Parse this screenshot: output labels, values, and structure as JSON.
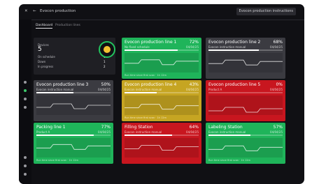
{
  "header": {
    "title": "Evocon production",
    "action_label": "Evocon production instructions"
  },
  "tabs": [
    "Dashboard",
    "Production lines"
  ],
  "summary": {
    "label": "Devices",
    "total": "5",
    "rows": [
      {
        "label": "On schedule",
        "value": "1"
      },
      {
        "label": "Down",
        "value": "1"
      },
      {
        "label": "In progress",
        "value": "2"
      }
    ]
  },
  "cards": [
    {
      "title": "Evocon production line 1",
      "subtitle": "No fixed schedule",
      "percent": "72%",
      "progress": 0.72,
      "meta": "04/04/25",
      "status": "green",
      "foot": "Run time since first scan · 1h 12m"
    },
    {
      "title": "Evocon production line 2",
      "subtitle": "Evocon instruction manual",
      "percent": "68%",
      "progress": 0.68,
      "meta": "04/04/25",
      "status": "gray",
      "foot": ""
    },
    {
      "title": "Evocon production line 3",
      "subtitle": "Evocon instruction manual",
      "percent": "50%",
      "progress": 0.5,
      "meta": "04/04/25",
      "status": "gray",
      "foot": ""
    },
    {
      "title": "Evocon production line 4",
      "subtitle": "Evocon instruction manual",
      "percent": "43%",
      "progress": 0.43,
      "meta": "04/04/25",
      "status": "yellow",
      "foot": "Run time since first scan · 1h 12m"
    },
    {
      "title": "Evocon production line 5",
      "subtitle": "Product A",
      "percent": "0%",
      "progress": 0.0,
      "meta": "04/04/25",
      "status": "red",
      "foot": ""
    },
    {
      "title": "Packing line 1",
      "subtitle": "Product A",
      "percent": "77%",
      "progress": 0.77,
      "meta": "04/04/25",
      "status": "green",
      "foot": "Run time since first scan · 1h 12m"
    },
    {
      "title": "Filling Station",
      "subtitle": "Evocon instruction manual",
      "percent": "64%",
      "progress": 0.64,
      "meta": "04/04/25",
      "status": "red",
      "foot": ""
    },
    {
      "title": "Labeling Station",
      "subtitle": "Evocon instruction manual",
      "percent": "57%",
      "progress": 0.57,
      "meta": "04/04/25",
      "status": "green",
      "foot": "Run time since first scan · 1h 12m"
    }
  ],
  "colors": {
    "green": "#1fb45a",
    "yellow": "#c6a522",
    "red": "#c8161f",
    "gray": "#3b3b41"
  }
}
